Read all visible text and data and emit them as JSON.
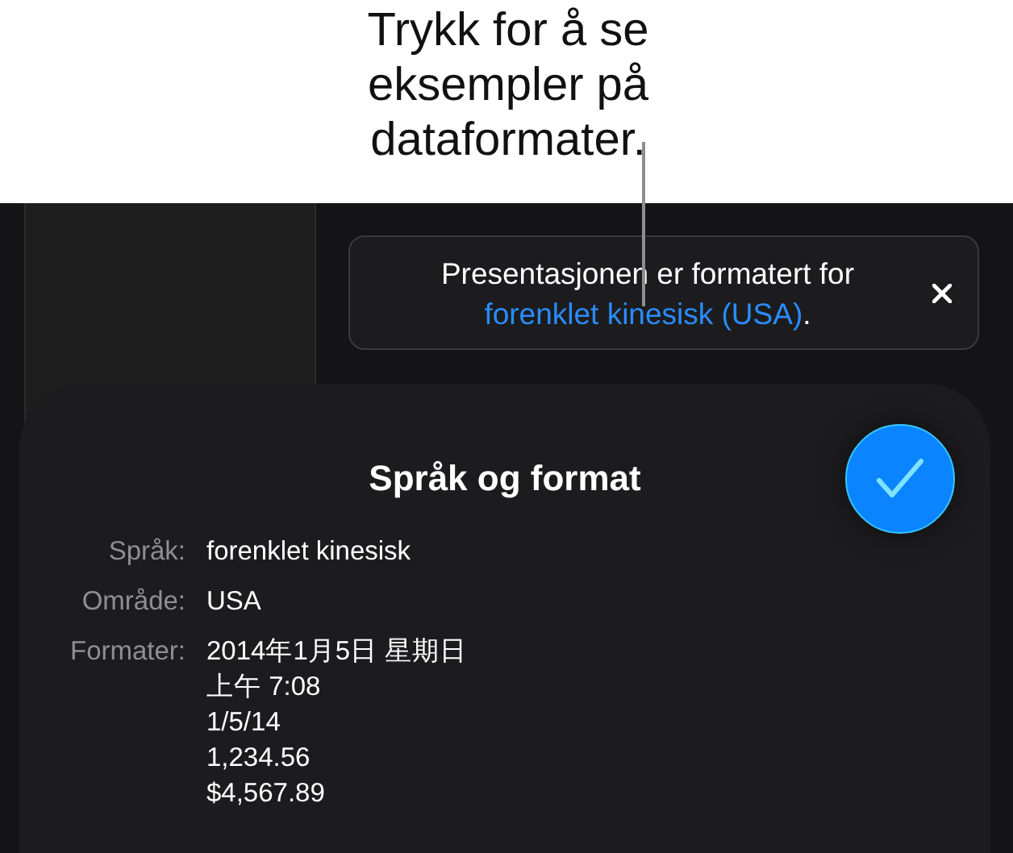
{
  "callout": {
    "text": "Trykk for å se eksempler på dataformater."
  },
  "banner": {
    "text_before": "Presentasjonen er formatert for ",
    "link": "forenklet kinesisk (USA)",
    "text_after": "."
  },
  "card": {
    "title": "Språk og format",
    "rows": [
      {
        "label": "Språk:",
        "values": [
          "forenklet kinesisk"
        ]
      },
      {
        "label": "Område:",
        "values": [
          "USA"
        ]
      },
      {
        "label": "Formater:",
        "values": [
          "2014年1月5日 星期日",
          "上午 7:08",
          "1/5/14",
          "1,234.56",
          "$4,567.89"
        ]
      }
    ]
  }
}
